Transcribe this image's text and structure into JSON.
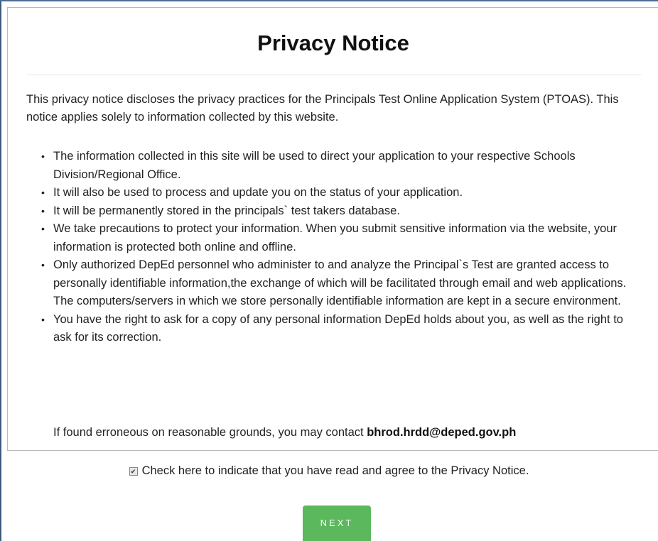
{
  "notice": {
    "title": "Privacy Notice",
    "intro": "This privacy notice discloses the privacy practices for the Principals Test Online Application System (PTOAS). This notice applies solely to information collected by this website.",
    "items": [
      "The information collected in this site will be used to direct your application to your respective Schools Division/Regional Office.",
      "It will also be used to process and update you on the status of your application.",
      "It will be permanently stored in the principals` test takers database.",
      "We take precautions to protect your information. When you submit sensitive information via the website, your information is protected both online and offline.",
      "Only authorized DepEd personnel who administer to and analyze the Principal`s Test are granted access to personally identifiable information,the exchange of which will be facilitated through email and web applications. The computers/servers in which we store personally identifiable information are kept in a secure environment.",
      "You have the right to ask for a copy of any personal information DepEd holds about you, as well as the right to ask for its correction."
    ],
    "contact_text": "If found erroneous on reasonable grounds, you may contact ",
    "contact_email": "bhrod.hrdd@deped.gov.ph"
  },
  "agreement": {
    "checked": true,
    "label": "Check here to indicate that you have read and agree to the Privacy Notice."
  },
  "actions": {
    "next_label": "NEXT",
    "next_color": "#5cb85c"
  }
}
